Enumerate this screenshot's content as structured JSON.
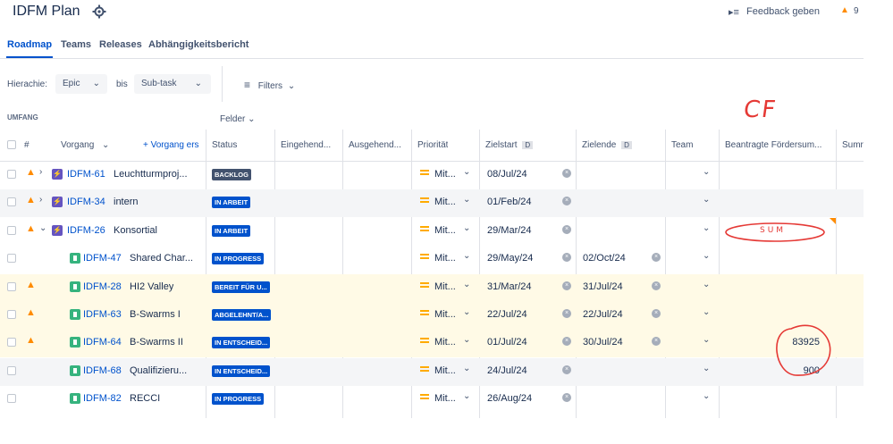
{
  "header": {
    "title": "IDFM Plan",
    "feedback_label": "Feedback geben",
    "warning_count": "9"
  },
  "tabs": [
    "Roadmap",
    "Teams",
    "Releases",
    "Abhängigkeitsbericht"
  ],
  "filters": {
    "hierarchy_label": "Hierachie:",
    "from_value": "Epic",
    "to_label": "bis",
    "to_value": "Sub-task",
    "filters_label": "Filters"
  },
  "grid": {
    "scope_label": "UMFANG",
    "fields_label": "Felder",
    "annotation_cf": "CF",
    "annotation_sum": "SUM",
    "columns": {
      "hash": "#",
      "vorgang": "Vorgang",
      "create": "+ Vorgang ers",
      "status": "Status",
      "incoming": "Eingehend...",
      "outgoing": "Ausgehend...",
      "priority": "Priorität",
      "start": "Zielstart",
      "start_badge": "D",
      "end": "Zielende",
      "end_badge": "D",
      "team": "Team",
      "funding": "Beantragte Fördersum...",
      "sum": "Sumr"
    },
    "rows": [
      {
        "warn": true,
        "expand": ">",
        "type": "epic",
        "key": "IDFM-61",
        "summary": "Leuchtturmproj...",
        "status": "BACKLOG",
        "status_color": "dark",
        "priority": "Mit...",
        "start": "08/Jul/24",
        "end": "",
        "funding": ""
      },
      {
        "warn": true,
        "expand": ">",
        "type": "epic",
        "key": "IDFM-34",
        "summary": "intern",
        "status": "IN ARBEIT",
        "status_color": "blue",
        "priority": "Mit...",
        "start": "01/Feb/24",
        "end": "",
        "funding": ""
      },
      {
        "warn": true,
        "expand": "v",
        "type": "epic",
        "key": "IDFM-26",
        "summary": "Konsortial",
        "status": "IN ARBEIT",
        "status_color": "blue",
        "priority": "Mit...",
        "start": "29/Mar/24",
        "end": "",
        "funding": ""
      },
      {
        "warn": false,
        "expand": "",
        "type": "story",
        "key": "IDFM-47",
        "summary": "Shared Char...",
        "status": "IN PROGRESS",
        "status_color": "blue",
        "priority": "Mit...",
        "start": "29/May/24",
        "end": "02/Oct/24",
        "funding": ""
      },
      {
        "warn": true,
        "expand": "",
        "type": "story",
        "key": "IDFM-28",
        "summary": "HI2 Valley",
        "status": "BEREIT FÜR U...",
        "status_color": "blue",
        "priority": "Mit...",
        "start": "31/Mar/24",
        "end": "31/Jul/24",
        "funding": ""
      },
      {
        "warn": true,
        "expand": "",
        "type": "story",
        "key": "IDFM-63",
        "summary": "B-Swarms I",
        "status": "ABGELEHNT/A...",
        "status_color": "blue",
        "priority": "Mit...",
        "start": "22/Jul/24",
        "end": "22/Jul/24",
        "funding": ""
      },
      {
        "warn": true,
        "expand": "",
        "type": "story",
        "key": "IDFM-64",
        "summary": "B-Swarms II",
        "status": "IN ENTSCHEID...",
        "status_color": "blue",
        "priority": "Mit...",
        "start": "01/Jul/24",
        "end": "30/Jul/24",
        "funding": "83925"
      },
      {
        "warn": false,
        "expand": "",
        "type": "story",
        "key": "IDFM-68",
        "summary": "Qualifizieru...",
        "status": "IN ENTSCHEID...",
        "status_color": "blue",
        "priority": "Mit...",
        "start": "24/Jul/24",
        "end": "",
        "funding": "900"
      },
      {
        "warn": false,
        "expand": "",
        "type": "story",
        "key": "IDFM-82",
        "summary": "RECCI",
        "status": "IN PROGRESS",
        "status_color": "blue",
        "priority": "Mit...",
        "start": "26/Aug/24",
        "end": "",
        "funding": ""
      }
    ]
  }
}
